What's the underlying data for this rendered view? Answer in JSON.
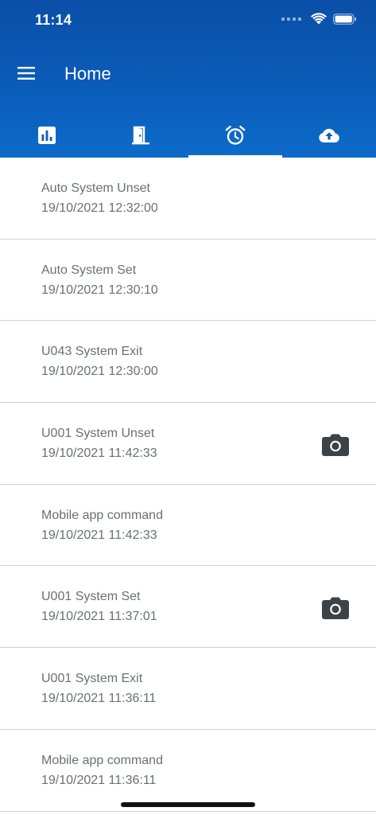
{
  "status_bar": {
    "time": "11:14"
  },
  "app_bar": {
    "title": "Home"
  },
  "tabs": [
    {
      "icon": "bar-chart-icon",
      "active": false
    },
    {
      "icon": "door-icon",
      "active": false
    },
    {
      "icon": "alarm-clock-icon",
      "active": true
    },
    {
      "icon": "cloud-upload-icon",
      "active": false
    }
  ],
  "events": [
    {
      "title": "Auto System Unset",
      "time": "19/10/2021 12:32:00",
      "has_camera": false
    },
    {
      "title": "Auto System Set",
      "time": "19/10/2021 12:30:10",
      "has_camera": false
    },
    {
      "title": "U043 System Exit",
      "time": "19/10/2021 12:30:00",
      "has_camera": false
    },
    {
      "title": "U001 System Unset",
      "time": "19/10/2021 11:42:33",
      "has_camera": true
    },
    {
      "title": "Mobile app command",
      "time": "19/10/2021 11:42:33",
      "has_camera": false
    },
    {
      "title": "U001 System Set",
      "time": "19/10/2021 11:37:01",
      "has_camera": true
    },
    {
      "title": "U001 System Exit",
      "time": "19/10/2021 11:36:11",
      "has_camera": false
    },
    {
      "title": "Mobile app command",
      "time": "19/10/2021 11:36:11",
      "has_camera": false
    }
  ],
  "colors": {
    "header": "#0b5cb9",
    "text": "#6b6f73",
    "icon_dark": "#3d4247"
  }
}
